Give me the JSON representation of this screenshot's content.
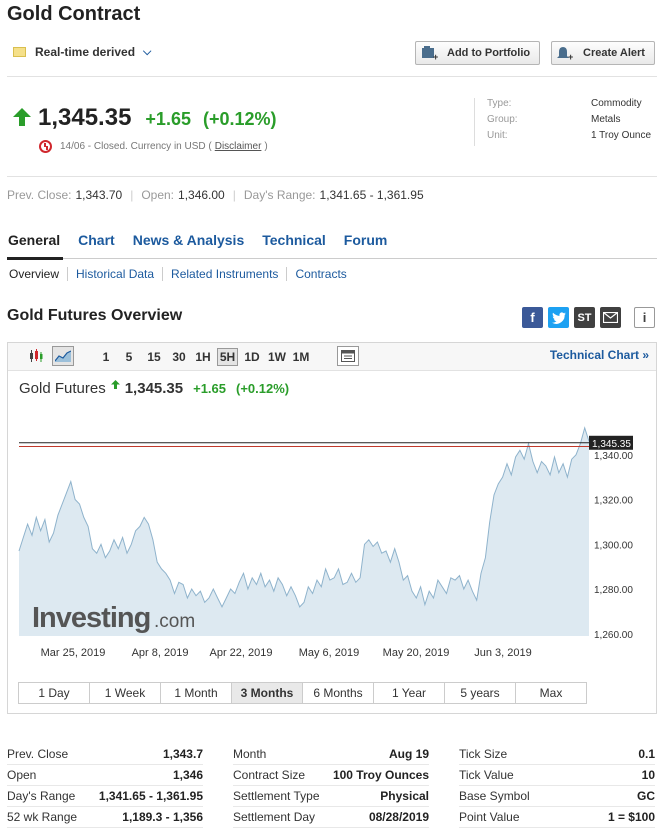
{
  "header": {
    "title": "Gold Contract",
    "realtime_label": "Real-time derived",
    "add_portfolio": "Add to Portfolio",
    "create_alert": "Create Alert"
  },
  "quote": {
    "price": "1,345.35",
    "change": "+1.65",
    "change_pct": "(+0.12%)",
    "closed_text": "14/06 - Closed. Currency in USD (",
    "disclaimer": "Disclaimer",
    "closed_tail": ")"
  },
  "meta": [
    {
      "k": "Type:",
      "v": "Commodity"
    },
    {
      "k": "Group:",
      "v": "Metals"
    },
    {
      "k": "Unit:",
      "v": "1 Troy Ounce"
    }
  ],
  "summary": {
    "prev_close_label": "Prev. Close:",
    "prev_close": "1,343.70",
    "open_label": "Open:",
    "open": "1,346.00",
    "range_label": "Day's Range:",
    "range": "1,341.65 - 1,361.95"
  },
  "tabs": [
    "General",
    "Chart",
    "News & Analysis",
    "Technical",
    "Forum"
  ],
  "subtabs": [
    "Overview",
    "Historical Data",
    "Related Instruments",
    "Contracts"
  ],
  "section_title": "Gold Futures Overview",
  "toolbar": {
    "intervals": [
      "1",
      "5",
      "15",
      "30",
      "1H",
      "5H",
      "1D",
      "1W",
      "1M"
    ],
    "selected": "5H",
    "tech_chart": "Technical Chart »"
  },
  "chart_head": {
    "name": "Gold Futures",
    "price": "1,345.35",
    "change": "+1.65",
    "pct": "(+0.12%)"
  },
  "watermark": {
    "brand": "Investing",
    "suffix": ".com"
  },
  "ranges": [
    "1 Day",
    "1 Week",
    "1 Month",
    "3 Months",
    "6 Months",
    "1 Year",
    "5 years",
    "Max"
  ],
  "selected_range": "3 Months",
  "colors": {
    "up": "#2a9d2a",
    "link": "#1c5a9e",
    "area_fill": "#dde9f1",
    "area_line": "#8fb3cc"
  },
  "chart_data": {
    "type": "area",
    "x_ticks": [
      "Mar 25, 2019",
      "Apr 8, 2019",
      "Apr 22, 2019",
      "May 6, 2019",
      "May 20, 2019",
      "Jun 3, 2019"
    ],
    "y_ticks": [
      "1,260.00",
      "1,280.00",
      "1,300.00",
      "1,320.00",
      "1,340.00"
    ],
    "ylim": [
      1259,
      1360
    ],
    "last_label": "1,345.35",
    "values": [
      1297,
      1303,
      1309,
      1304,
      1312,
      1306,
      1311,
      1301,
      1305,
      1313,
      1318,
      1323,
      1328,
      1320,
      1318,
      1312,
      1308,
      1298,
      1296,
      1300,
      1294,
      1297,
      1302,
      1298,
      1303,
      1296,
      1300,
      1306,
      1308,
      1312,
      1309,
      1302,
      1292,
      1289,
      1287,
      1284,
      1278,
      1283,
      1282,
      1276,
      1280,
      1277,
      1279,
      1274,
      1276,
      1280,
      1276,
      1272,
      1276,
      1280,
      1278,
      1283,
      1287,
      1280,
      1285,
      1282,
      1287,
      1281,
      1284,
      1279,
      1285,
      1282,
      1277,
      1281,
      1277,
      1272,
      1274,
      1281,
      1278,
      1284,
      1281,
      1289,
      1284,
      1285,
      1289,
      1282,
      1283,
      1287,
      1283,
      1285,
      1300,
      1302,
      1299,
      1301,
      1296,
      1297,
      1292,
      1298,
      1292,
      1284,
      1286,
      1279,
      1276,
      1281,
      1273,
      1279,
      1276,
      1284,
      1281,
      1278,
      1285,
      1284,
      1286,
      1280,
      1284,
      1279,
      1275,
      1287,
      1294,
      1310,
      1322,
      1327,
      1330,
      1336,
      1331,
      1339,
      1342,
      1338,
      1345,
      1337,
      1332,
      1337,
      1335,
      1331,
      1339,
      1332,
      1336,
      1330,
      1338,
      1340,
      1345,
      1352,
      1346
    ]
  },
  "stats": [
    [
      {
        "k": "Prev. Close",
        "v": "1,343.7"
      },
      {
        "k": "Open",
        "v": "1,346"
      },
      {
        "k": "Day's Range",
        "v": "1,341.65 - 1,361.95"
      },
      {
        "k": "52 wk Range",
        "v": "1,189.3 - 1,356"
      }
    ],
    [
      {
        "k": "Month",
        "v": "Aug 19"
      },
      {
        "k": "Contract Size",
        "v": "100 Troy Ounces"
      },
      {
        "k": "Settlement Type",
        "v": "Physical"
      },
      {
        "k": "Settlement Day",
        "v": "08/28/2019"
      }
    ],
    [
      {
        "k": "Tick Size",
        "v": "0.1"
      },
      {
        "k": "Tick Value",
        "v": "10"
      },
      {
        "k": "Base Symbol",
        "v": "GC"
      },
      {
        "k": "Point Value",
        "v": "1 = $100"
      }
    ]
  ]
}
